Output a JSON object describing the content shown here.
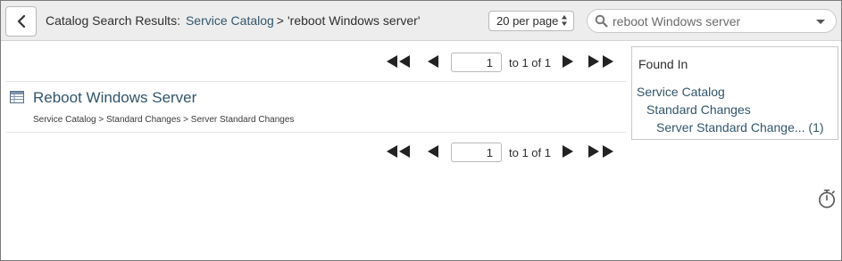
{
  "header": {
    "back_icon": "chevron-left-icon",
    "label": "Catalog Search Results:",
    "breadcrumb_catalog": "Service Catalog",
    "breadcrumb_separator": ">",
    "breadcrumb_query": "'reboot Windows server'",
    "per_page": "20 per page",
    "search_value": "reboot Windows server",
    "search_icon": "search-icon"
  },
  "pager": {
    "page": "1",
    "of_text": "to 1 of 1"
  },
  "result": {
    "title": "Reboot Windows Server",
    "path": "Service Catalog > Standard Changes > Server Standard Changes",
    "icon": "catalog-item-icon"
  },
  "found_in": {
    "title": "Found In",
    "level1": "Service Catalog",
    "level2": "Standard Changes",
    "level3": "Server Standard Change... (1)"
  },
  "colors": {
    "link": "#32566b",
    "header_bg": "#ededed"
  }
}
